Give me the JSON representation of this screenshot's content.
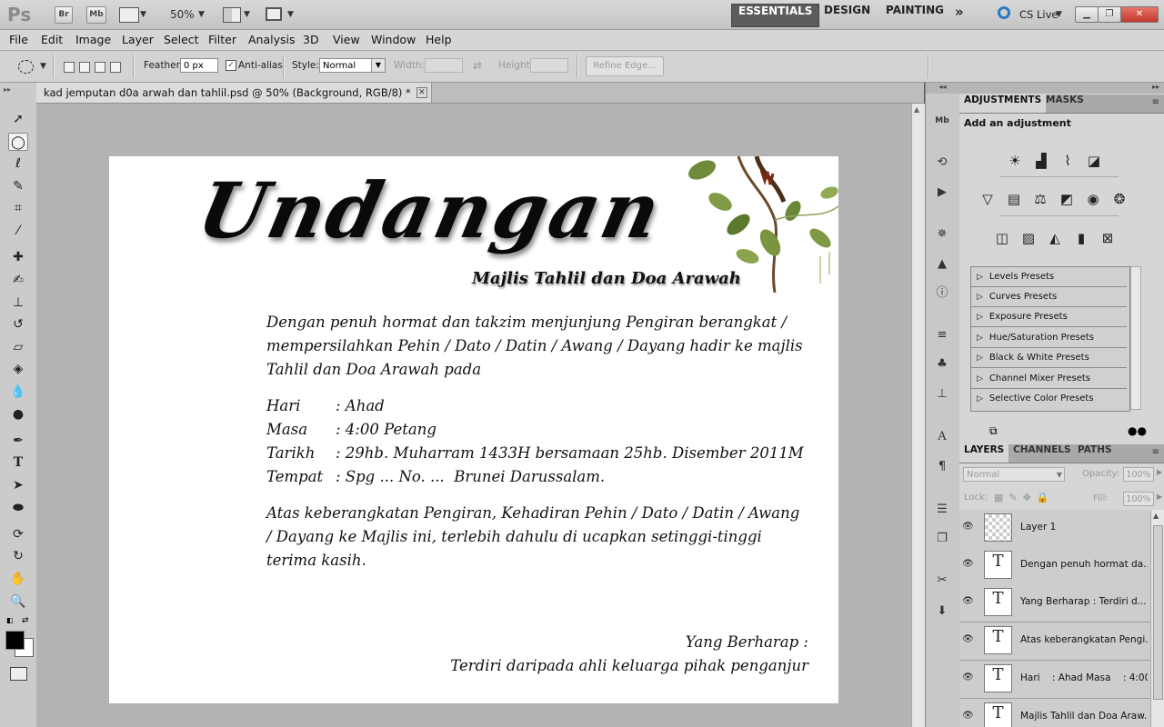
{
  "app": {
    "logo": "Ps",
    "bridge_btn": "Br",
    "minibridge_btn": "Mb",
    "zoom": "50%",
    "workspaces": [
      "ESSENTIALS",
      "DESIGN",
      "PAINTING"
    ],
    "more_workspaces": "»",
    "cs_live": "CS Live"
  },
  "menu": [
    "File",
    "Edit",
    "Image",
    "Layer",
    "Select",
    "Filter",
    "Analysis",
    "3D",
    "View",
    "Window",
    "Help"
  ],
  "options": {
    "feather_label": "Feather:",
    "feather_value": "0 px",
    "antialias_label": "Anti-alias",
    "style_label": "Style:",
    "style_value": "Normal",
    "width_label": "Width:",
    "height_label": "Height:",
    "refine_edge": "Refine Edge..."
  },
  "document": {
    "tab_title": "kad jemputan d0a arwah dan tahlil.psd @ 50% (Background, RGB/8) *",
    "heading": "Undangan",
    "subheading": "Majlis Tahlil dan Doa Arawah",
    "para1": [
      "Dengan penuh hormat dan takzim menjunjung Pengiran berangkat /",
      "mempersilahkan Pehin / Dato / Datin / Awang / Dayang hadir ke majlis",
      "Tahlil dan Doa Arawah pada"
    ],
    "details": [
      {
        "label": "Hari",
        "value": ": Ahad"
      },
      {
        "label": "Masa",
        "value": ": 4:00 Petang"
      },
      {
        "label": "Tarikh",
        "value": ": 29hb. Muharram 1433H bersamaan 25hb. Disember 2011M"
      },
      {
        "label": "Tempat",
        "value": ": Spg ... No. ...  Brunei Darussalam."
      }
    ],
    "para2": [
      "Atas keberangkatan Pengiran, Kehadiran Pehin / Dato / Datin / Awang",
      "/ Dayang ke Majlis ini, terlebih dahulu di ucapkan setinggi-tinggi",
      "terima kasih."
    ],
    "closing1": "Yang Berharap :",
    "closing2": "Terdiri daripada ahli keluarga pihak penganjur"
  },
  "adjustments": {
    "tabs": [
      "ADJUSTMENTS",
      "MASKS"
    ],
    "title": "Add an adjustment",
    "presets": [
      "Levels Presets",
      "Curves Presets",
      "Exposure Presets",
      "Hue/Saturation Presets",
      "Black & White Presets",
      "Channel Mixer Presets",
      "Selective Color Presets"
    ]
  },
  "layers": {
    "tabs": [
      "LAYERS",
      "CHANNELS",
      "PATHS"
    ],
    "blend_mode": "Normal",
    "opacity_label": "Opacity:",
    "opacity_value": "100%",
    "lock_label": "Lock:",
    "fill_label": "Fill:",
    "fill_value": "100%",
    "items": [
      {
        "name": "Layer 1",
        "thumb": ""
      },
      {
        "name": "Dengan penuh hormat da...",
        "thumb": "T"
      },
      {
        "name": "Yang Berharap : Terdiri d...",
        "thumb": "T"
      },
      {
        "name": "Atas keberangkatan Pengi...",
        "thumb": "T"
      },
      {
        "name": "Hari    : Ahad Masa    : 4:00...",
        "thumb": "T"
      },
      {
        "name": "Majlis Tahlil dan Doa Araw...",
        "thumb": "T"
      }
    ]
  },
  "colors": {
    "workspace_bg": "#b3b3b3",
    "document_bg": "#ffffff",
    "foreground": "#000000",
    "background": "#ffffff"
  }
}
